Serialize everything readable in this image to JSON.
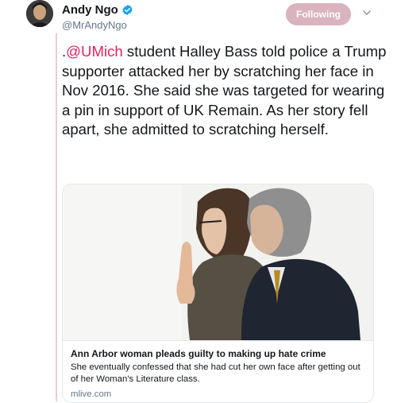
{
  "author": {
    "name": "Andy Ngo",
    "handle": "@MrAndyNgo"
  },
  "follow_button_label": "Following",
  "tweet": {
    "prefix": ".",
    "mention": "@UMich",
    "body": " student Halley Bass told police a Trump supporter attacked her by scratching her face in Nov 2016. She said she was targeted for wearing a pin in support of UK Remain. As her story fell apart, she admitted to scratching herself."
  },
  "link_card": {
    "title": "Ann Arbor woman pleads guilty to making up hate crime",
    "description": "She eventually confessed that she had cut her own face after getting out of her Woman's Literature class.",
    "domain": "mlive.com"
  },
  "colors": {
    "mention": "#e0245e",
    "follow_button": "#d9b3bd",
    "verified": "#1da1f2"
  },
  "icons": [
    "verified-badge-icon",
    "chevron-down-icon"
  ]
}
